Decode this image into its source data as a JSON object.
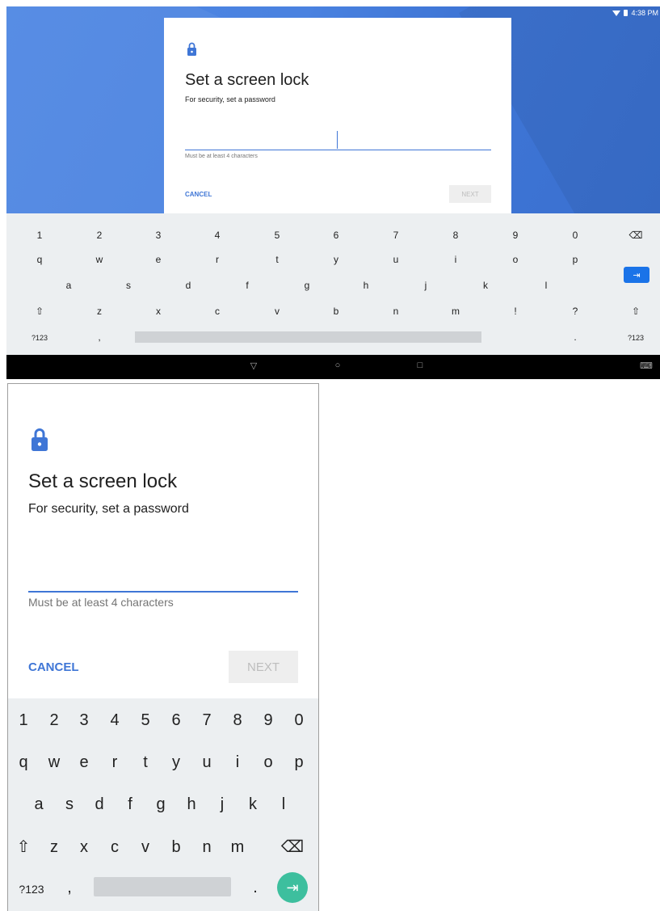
{
  "tablet": {
    "status_time": "4:38 PM",
    "dialog": {
      "title": "Set a screen lock",
      "subtitle": "For security, set a password",
      "hint": "Must be at least 4 characters",
      "cancel_label": "CANCEL",
      "next_label": "NEXT"
    },
    "keyboard": {
      "row1": [
        "1",
        "2",
        "3",
        "4",
        "5",
        "6",
        "7",
        "8",
        "9",
        "0"
      ],
      "row2": [
        "q",
        "w",
        "e",
        "r",
        "t",
        "y",
        "u",
        "i",
        "o",
        "p"
      ],
      "row3": [
        "a",
        "s",
        "d",
        "f",
        "g",
        "h",
        "j",
        "k",
        "l"
      ],
      "row4": [
        "z",
        "x",
        "c",
        "v",
        "b",
        "n",
        "m",
        "!",
        "?"
      ],
      "symbols_label": "?123",
      "comma": ",",
      "period": ".",
      "backspace_icon": "backspace-icon",
      "shift_icon": "shift-icon",
      "enter_icon": "tab-next-icon"
    },
    "nav": {
      "back_icon": "back-triangle-icon",
      "home_icon": "home-circle-icon",
      "recents_icon": "recents-square-icon",
      "keyboard_icon": "keyboard-icon"
    }
  },
  "phone": {
    "dialog": {
      "title": "Set a screen lock",
      "subtitle": "For security, set a password",
      "hint": "Must be at least 4 characters",
      "cancel_label": "CANCEL",
      "next_label": "NEXT"
    },
    "keyboard": {
      "row1": [
        "1",
        "2",
        "3",
        "4",
        "5",
        "6",
        "7",
        "8",
        "9",
        "0"
      ],
      "row2": [
        "q",
        "w",
        "e",
        "r",
        "t",
        "y",
        "u",
        "i",
        "o",
        "p"
      ],
      "row3": [
        "a",
        "s",
        "d",
        "f",
        "g",
        "h",
        "j",
        "k",
        "l"
      ],
      "row4": [
        "z",
        "x",
        "c",
        "v",
        "b",
        "n",
        "m"
      ],
      "symbols_label": "?123",
      "comma": ",",
      "period": ".",
      "backspace_icon": "backspace-icon",
      "shift_icon": "shift-icon",
      "enter_icon": "tab-next-icon"
    }
  },
  "colors": {
    "accent": "#3f76d6",
    "tablet_enter": "#1a73e8",
    "phone_enter": "#3dbf9e",
    "keyboard_bg": "#eceff1",
    "next_disabled_bg": "#eeeeee"
  }
}
